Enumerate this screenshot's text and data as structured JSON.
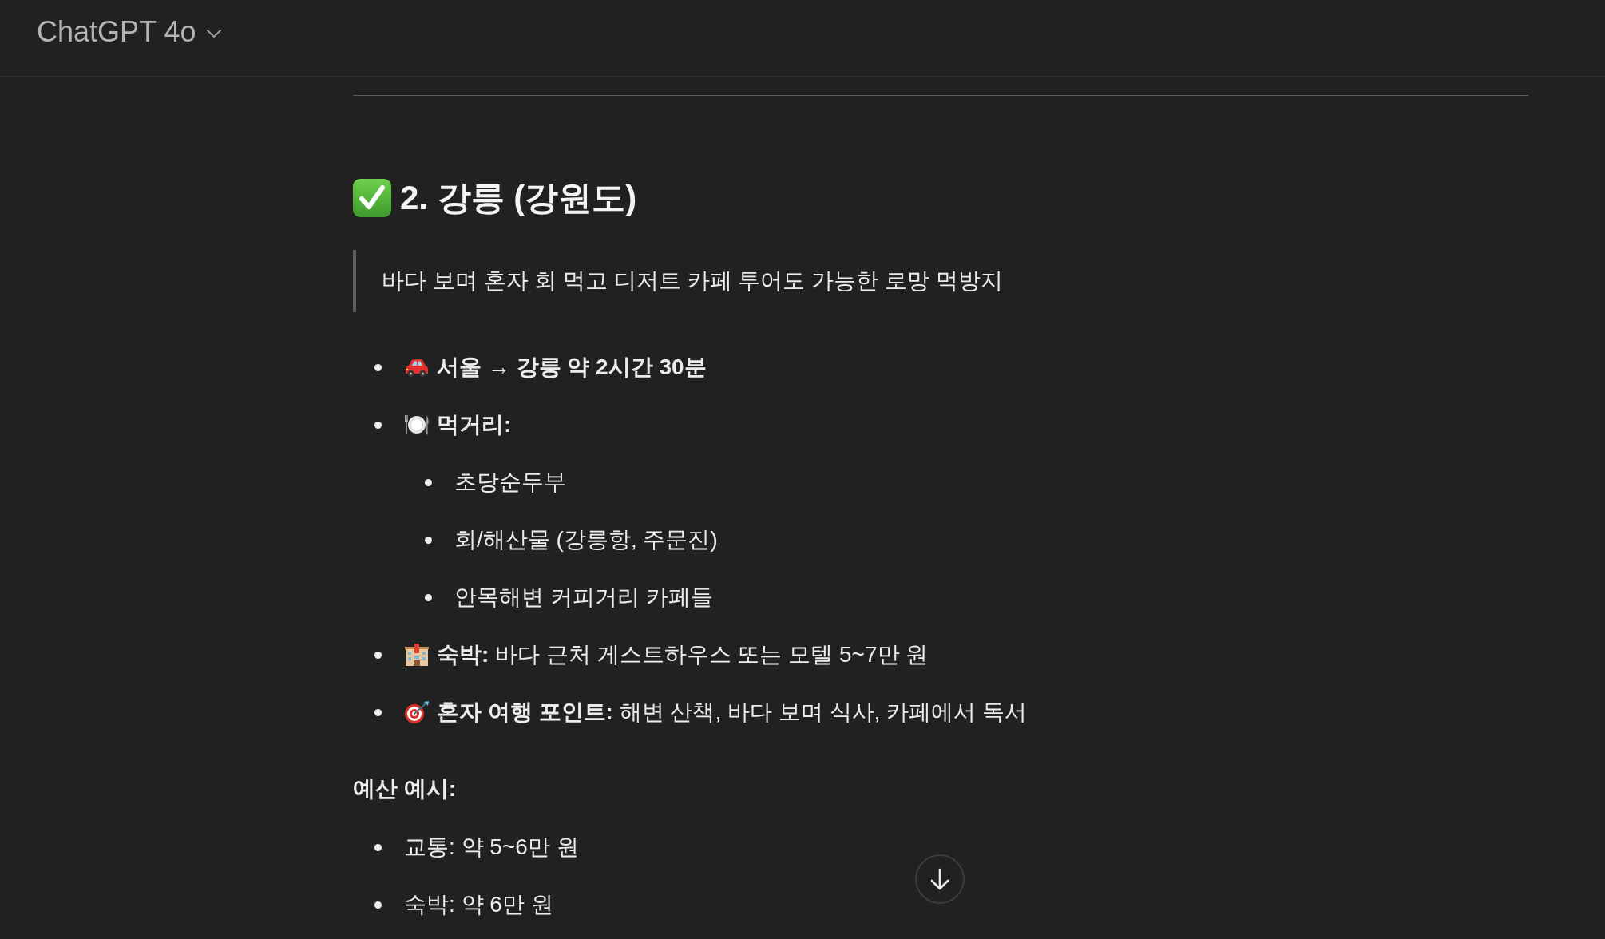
{
  "header": {
    "model_selector": "ChatGPT 4o"
  },
  "section": {
    "heading": "2. 강릉 (강원도)",
    "quote": "바다 보며 혼자 회 먹고 디저트 카페 투어도 가능한 로망 먹방지",
    "items": [
      {
        "kind": "transport",
        "text": "**서울 → 강릉 약 2시간 30분**"
      },
      {
        "kind": "food",
        "text": "**먹거리:**",
        "children": [
          {
            "text": "초당순두부"
          },
          {
            "text": "회/해산물 (강릉항, 주문진)"
          },
          {
            "text": "안목해변 커피거리 카페들"
          }
        ]
      },
      {
        "kind": "lodging",
        "text": "**숙박:** 바다 근처 게스트하우스 또는 모텔 5~7만 원"
      },
      {
        "kind": "tip",
        "text": "**혼자 여행 포인트:** 해변 산책, 바다 보며 식사, 카페에서 독서"
      }
    ],
    "budget_label": "예산 예시:",
    "budget_items": [
      {
        "text": "교통: 약 5~6만 원"
      },
      {
        "text": "숙박: 약 6만 원"
      }
    ]
  }
}
